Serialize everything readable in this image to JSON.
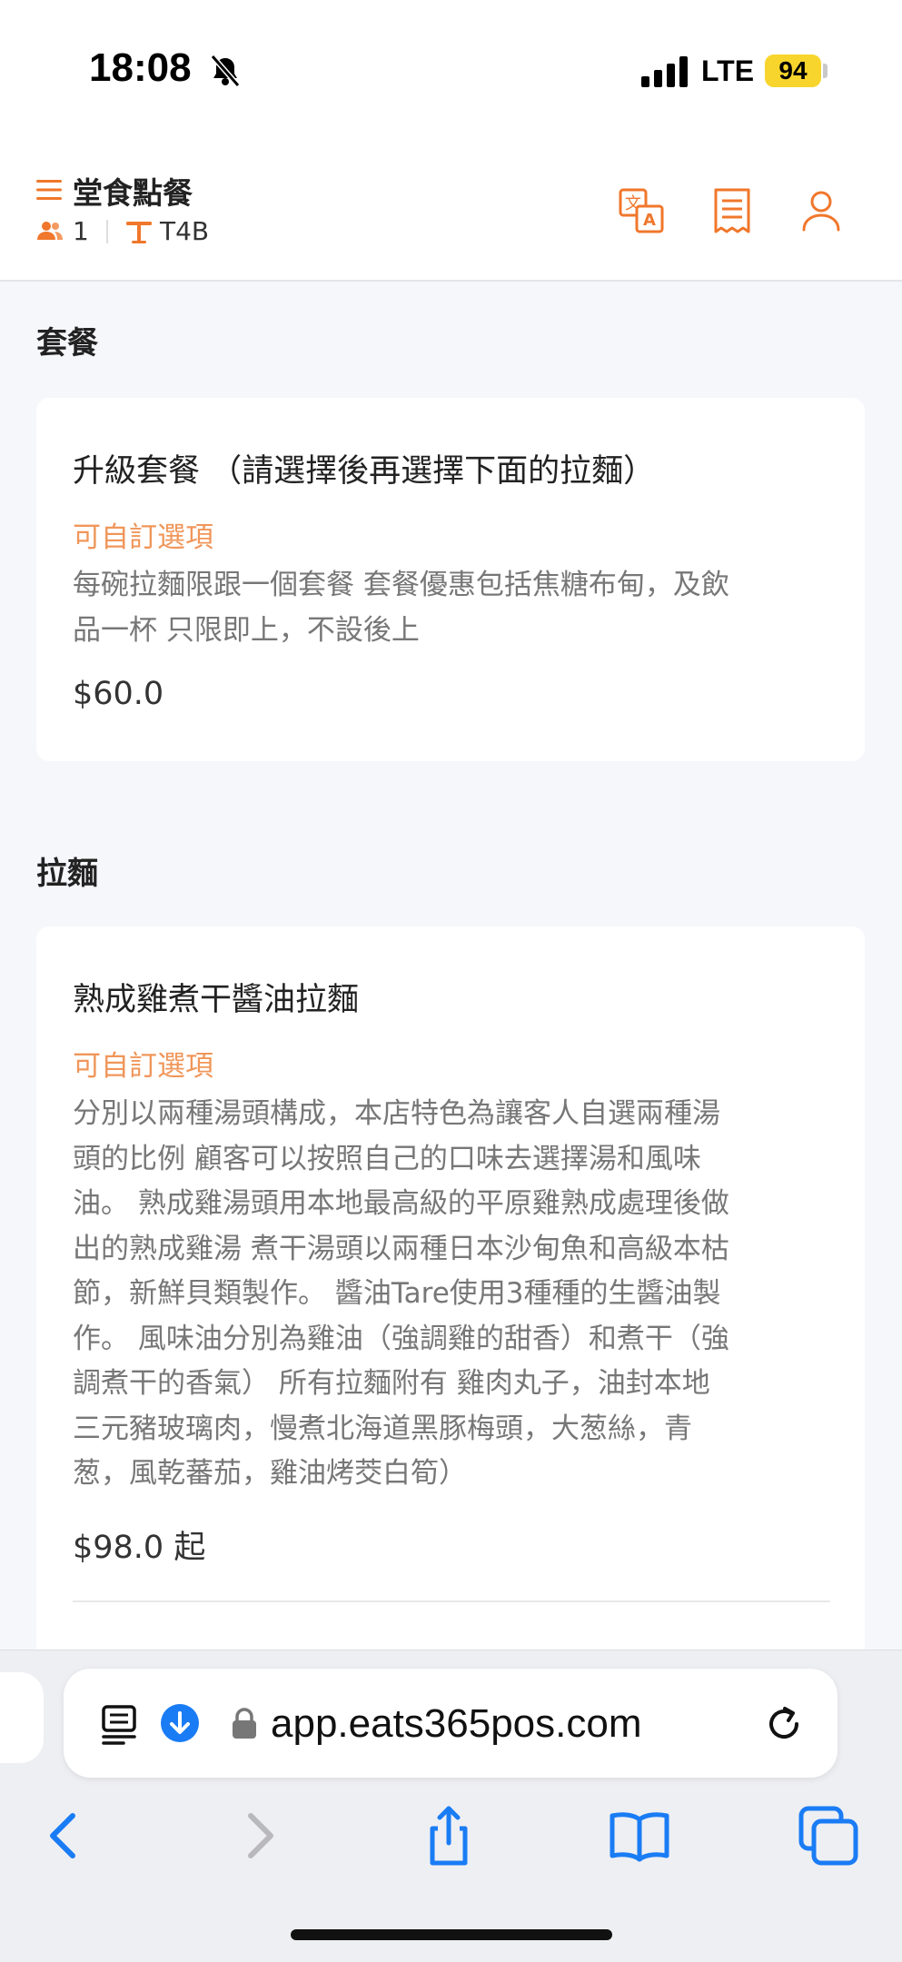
{
  "status_bar": {
    "time": "18:08",
    "network": "LTE",
    "battery": "94",
    "battery_color": "#f7d52c",
    "icons": [
      "bell-slash-icon",
      "signal-icon"
    ]
  },
  "header": {
    "title": "堂食點餐",
    "guest_count": "1",
    "table": "T4B",
    "accent_color": "#f0772b",
    "icons": [
      "menu-icon",
      "people-icon",
      "table-icon",
      "translate-icon",
      "receipt-icon",
      "user-icon"
    ]
  },
  "sections": [
    {
      "title": "套餐",
      "items": [
        {
          "name": "升級套餐 （請選擇後再選擇下面的拉麵）",
          "tag": "可自訂選項",
          "description_lines": [
            "每碗拉麵限跟一個套餐 套餐優惠包括焦糖布甸，及飲",
            "品一杯 只限即上，不設後上"
          ],
          "price": "$60.0"
        }
      ]
    },
    {
      "title": "拉麵",
      "items": [
        {
          "name": "熟成雞煮干醬油拉麵",
          "tag": "可自訂選項",
          "description_lines": [
            "分別以兩種湯頭構成，本店特色為讓客人自選兩種湯",
            "頭的比例 顧客可以按照自己的口味去選擇湯和風味",
            "油。 熟成雞湯頭用本地最高級的平原雞熟成處理後做",
            "出的熟成雞湯 煮干湯頭以兩種日本沙甸魚和高級本枯",
            "節，新鮮貝類製作。 醬油Tare使用3種種的生醬油製",
            "作。 風味油分別為雞油（強調雞的甜香）和煮干（強",
            "調煮干的香氣） 所有拉麵附有 雞肉丸子，油封本地",
            "三元豬玻璃肉，慢煮北海道黑豚梅頭，大葱絲，青",
            "葱，風乾蕃茄，雞油烤茭白筍）"
          ],
          "price": "$98.0 起"
        }
      ]
    }
  ],
  "browser": {
    "url": "app.eats365pos.com",
    "accent_color": "#1a7cf5",
    "icons": [
      "reader-icon",
      "download-icon",
      "lock-icon",
      "reload-icon",
      "back-icon",
      "forward-icon",
      "share-icon",
      "bookmarks-icon",
      "tabs-icon"
    ]
  }
}
